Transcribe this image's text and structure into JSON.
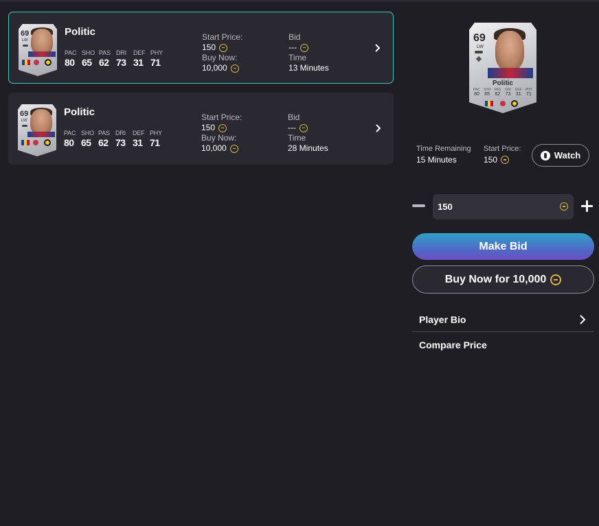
{
  "listings": [
    {
      "player": {
        "name": "Politic",
        "rating": "69",
        "position": "LW",
        "stats": [
          {
            "label": "PAC",
            "value": "80"
          },
          {
            "label": "SHO",
            "value": "65"
          },
          {
            "label": "PAS",
            "value": "62"
          },
          {
            "label": "DRI",
            "value": "73"
          },
          {
            "label": "DEF",
            "value": "31"
          },
          {
            "label": "PHY",
            "value": "71"
          }
        ]
      },
      "start_price_label": "Start Price:",
      "start_price": "150",
      "buy_now_label": "Buy Now:",
      "buy_now": "10,000",
      "bid_label": "Bid",
      "bid": "---",
      "time_label": "Time",
      "time": "13 Minutes",
      "selected": true
    },
    {
      "player": {
        "name": "Politic",
        "rating": "69",
        "position": "LW",
        "stats": [
          {
            "label": "PAC",
            "value": "80"
          },
          {
            "label": "SHO",
            "value": "65"
          },
          {
            "label": "PAS",
            "value": "62"
          },
          {
            "label": "DRI",
            "value": "73"
          },
          {
            "label": "DEF",
            "value": "31"
          },
          {
            "label": "PHY",
            "value": "71"
          }
        ]
      },
      "start_price_label": "Start Price:",
      "start_price": "150",
      "buy_now_label": "Buy Now:",
      "buy_now": "10,000",
      "bid_label": "Bid",
      "bid": "---",
      "time_label": "Time",
      "time": "28 Minutes",
      "selected": false
    }
  ],
  "detail": {
    "card": {
      "name": "Politic",
      "rating": "69",
      "position": "LW",
      "stats": [
        {
          "label": "PAC",
          "value": "80"
        },
        {
          "label": "SHO",
          "value": "65"
        },
        {
          "label": "PAS",
          "value": "62"
        },
        {
          "label": "DRI",
          "value": "73"
        },
        {
          "label": "DEF",
          "value": "31"
        },
        {
          "label": "PHY",
          "value": "71"
        }
      ]
    },
    "time_remaining_label": "Time Remaining",
    "time_remaining": "15 Minutes",
    "start_price_label": "Start Price:",
    "start_price": "150",
    "watch_label": "Watch",
    "bid_value": "150",
    "make_bid_label": "Make Bid",
    "buy_now_label": "Buy Now for 10,000",
    "menu": [
      {
        "label": "Player Bio"
      },
      {
        "label": "Compare Price"
      }
    ]
  },
  "colors": {
    "background": "#1f1e24",
    "row_background": "#2a2931",
    "selected_border": "#3fc7c1",
    "coin": "#d8b43e",
    "make_bid_gradient_start": "#2ea0c7",
    "make_bid_gradient_end": "#6a4fc3"
  },
  "icons": [
    "coin-icon",
    "chevron-right-icon",
    "watch-icon",
    "minus-icon",
    "plus-icon"
  ]
}
